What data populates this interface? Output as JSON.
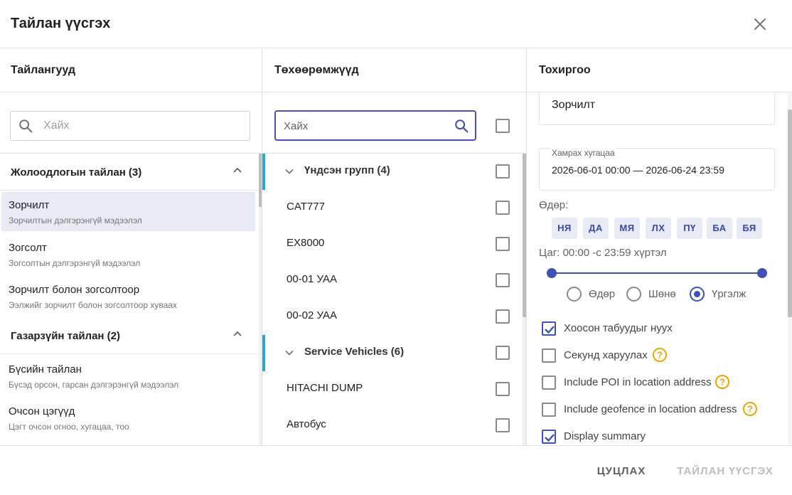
{
  "dialog": {
    "title": "Тайлан үүсгэх",
    "close_icon": "close-icon"
  },
  "reports": {
    "heading": "Тайлангууд",
    "search_placeholder": "Хайх",
    "groups": [
      {
        "title": "Жолоодлогын тайлан (3)",
        "expanded": true,
        "items": [
          {
            "title": "Зорчилт",
            "subtitle": "Зорчилтын дэлгэрэнгүй мэдээлэл",
            "selected": true
          },
          {
            "title": "Зогсолт",
            "subtitle": "Зогсолтын дэлгэрэнгүй мэдээлэл",
            "selected": false
          },
          {
            "title": "Зорчилт болон зогсолтоор",
            "subtitle": "Ээлжийг зорчилт болон зогсолтоор хуваах",
            "selected": false
          }
        ]
      },
      {
        "title": "Газарзүйн тайлан (2)",
        "expanded": true,
        "items": [
          {
            "title": "Бүсийн тайлан",
            "subtitle": "Бүсэд орсон, гарсан дэлгэрэнгүй мэдээлэл",
            "selected": false
          },
          {
            "title": "Очсон цэгүүд",
            "subtitle": "Цэгт очсон огноо, хугацаа, тоо",
            "selected": false
          }
        ]
      }
    ]
  },
  "devices": {
    "heading": "Төхөөрөмжүүд",
    "search_placeholder": "Хайх",
    "select_all_checked": false,
    "rows": [
      {
        "type": "group",
        "label": "Үндсэн групп (4)",
        "checked": false
      },
      {
        "type": "item",
        "label": "CAT777",
        "checked": false
      },
      {
        "type": "item",
        "label": "EX8000",
        "checked": false
      },
      {
        "type": "item",
        "label": "00-01 УАА",
        "checked": false
      },
      {
        "type": "item",
        "label": "00-02 УАА",
        "checked": false
      },
      {
        "type": "group",
        "label": "Service Vehicles (6)",
        "checked": false
      },
      {
        "type": "item",
        "label": "HITACHI DUMP",
        "checked": false
      },
      {
        "type": "item",
        "label": "Автобус",
        "checked": false
      }
    ]
  },
  "settings": {
    "heading": "Тохиргоо",
    "report_name": "Зорчилт",
    "range_label": "Хамрах хугацаа",
    "range_value": "2026-06-01 00:00 — 2026-06-24 23:59",
    "days_label": "Өдөр:",
    "days": [
      "НЯ",
      "ДА",
      "МЯ",
      "ЛХ",
      "ПҮ",
      "БА",
      "БЯ"
    ],
    "time_label": "Цаг: 00:00 -с 23:59 хүртэл",
    "time_range": {
      "start": "00:00",
      "end": "23:59"
    },
    "mode_options": [
      {
        "label": "Өдөр",
        "checked": false
      },
      {
        "label": "Шөнө",
        "checked": false
      },
      {
        "label": "Үргэлж",
        "checked": true
      }
    ],
    "options": [
      {
        "label": "Хоосон табуудыг нуух",
        "checked": true,
        "help": false
      },
      {
        "label": "Секунд харуулах",
        "checked": false,
        "help": true
      },
      {
        "label": "Include POI in location address",
        "checked": false,
        "help": true
      },
      {
        "label": "Include geofence in location address",
        "checked": false,
        "help": true
      },
      {
        "label": "Display summary",
        "checked": true,
        "help": false
      }
    ]
  },
  "footer": {
    "cancel_label": "ЦУЦЛАХ",
    "generate_label": "ТАЙЛАН ҮҮСГЭХ"
  },
  "colors": {
    "accent": "#3f51b5",
    "selected_bg": "#e8eaf6",
    "group_bar": "#2aa7cf",
    "help": "#f0a500"
  }
}
